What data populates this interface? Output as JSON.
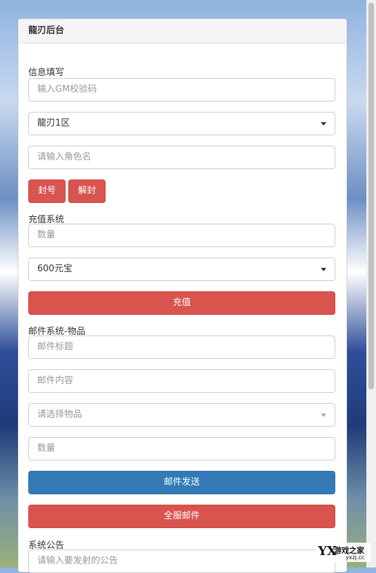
{
  "panel": {
    "title": "龍刃后台"
  },
  "info": {
    "label": "信息填写",
    "gm_placeholder": "输入GM校验码",
    "server_value": "龍刃1区",
    "role_placeholder": "请输入角色名",
    "ban_label": "封号",
    "unban_label": "解封"
  },
  "recharge": {
    "label": "充值系统",
    "qty_placeholder": "数量",
    "package_value": "600元宝",
    "submit_label": "充值"
  },
  "mail": {
    "label": "邮件系统-物品",
    "title_placeholder": "邮件标题",
    "content_placeholder": "邮件内容",
    "item_placeholder": "请选择物品",
    "qty_placeholder": "数量",
    "send_label": "邮件发送",
    "all_label": "全服邮件"
  },
  "notice": {
    "label": "系统公告",
    "placeholder": "请输入要发射的公告"
  },
  "watermark": {
    "mark": "YX",
    "name": "游戏之家",
    "domain": "yxzj.cc"
  }
}
